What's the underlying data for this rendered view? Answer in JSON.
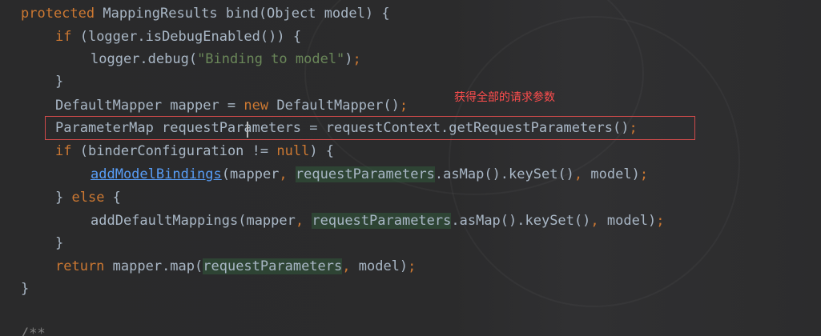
{
  "annotation": "获得全部的请求参数",
  "colors": {
    "keyword": "#cc7832",
    "string": "#6a8759",
    "text": "#a9b7c6",
    "method_link": "#589df6",
    "highlight_box": "#cf4a4a",
    "annotation": "#ff4d4d"
  },
  "code": {
    "l1": {
      "kw": "protected",
      "rest": " MappingResults bind(Object model) {"
    },
    "l2": {
      "kw": "if",
      "rest": " (logger.isDebugEnabled()) {"
    },
    "l3": {
      "pre": "logger.debug(",
      "str": "\"Binding to model\"",
      "post": ")",
      "semi": ";"
    },
    "l4": {
      "text": "}"
    },
    "l5": {
      "pre": "DefaultMapper mapper = ",
      "kw": "new",
      "post": " DefaultMapper()",
      "semi": ";"
    },
    "l6": {
      "pre": "ParameterMap requestParameters = requestContext.getRequestParameters()",
      "semi": ";"
    },
    "l7": {
      "kw": "if",
      "mid": " (binderConfiguration != ",
      "kw2": "null",
      "post": ") {"
    },
    "l8": {
      "method": "addModelBindings",
      "a": "(mapper",
      "comma1": ",",
      "sp": " ",
      "var": "requestParameters",
      "b": ".asMap().keySet()",
      "comma2": ",",
      "c": " model)",
      "semi": ";"
    },
    "l9": {
      "pre": "} ",
      "kw": "else",
      "post": " {"
    },
    "l10": {
      "a": "addDefaultMappings(mapper",
      "comma1": ",",
      "sp": " ",
      "var": "requestParameters",
      "b": ".asMap().keySet()",
      "comma2": ",",
      "c": " model)",
      "semi": ";"
    },
    "l11": {
      "text": "}"
    },
    "l12": {
      "kw": "return",
      "a": " mapper.map(",
      "var": "requestParameters",
      "comma": ",",
      "b": " model)",
      "semi": ";"
    },
    "l13": {
      "text": "}"
    },
    "l14": {
      "text": "/**"
    }
  }
}
